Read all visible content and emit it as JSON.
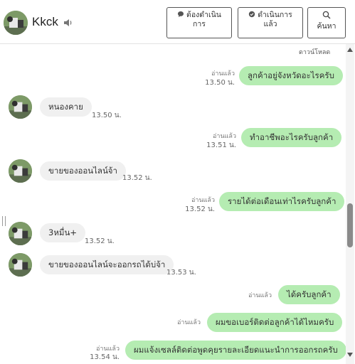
{
  "header": {
    "contact_name": "Kkck",
    "btn_todo_line1": "ต้องดำเนิน",
    "btn_todo_line2": "การ",
    "btn_done_line1": "ดำเนินการ",
    "btn_done_line2": "แล้ว",
    "btn_search_label": "ค้นหา"
  },
  "chat": {
    "download_label": "ดาวน์โหลด",
    "messages": [
      {
        "dir": "out",
        "text": "ลูกค้าอยู่จังหวัดอะไรครับ",
        "read": "อ่านแล้ว",
        "time": "13.50 น."
      },
      {
        "dir": "in",
        "text": "หนองคาย",
        "time": "13.50 น."
      },
      {
        "dir": "out",
        "text": "ทำอาชีพอะไรครับลูกค้า",
        "read": "อ่านแล้ว",
        "time": "13.51 น."
      },
      {
        "dir": "in",
        "text": "ขายของออนไลน์จ้า",
        "time": "13.52 น."
      },
      {
        "dir": "out",
        "text": "รายได้ต่อเดือนเท่าไรครับลูกค้า",
        "read": "อ่านแล้ว",
        "time": "13.52 น."
      },
      {
        "dir": "in",
        "text": "3หมื่น+",
        "time": "13.52 น."
      },
      {
        "dir": "in",
        "text": "ขายของออนไลน์จะออกรถได้บ่จ้า",
        "time": "13.53 น."
      },
      {
        "dir": "out",
        "text": "ได้ครับลูกค้า",
        "read": "อ่านแล้ว",
        "time": ""
      },
      {
        "dir": "out",
        "text": "ผมขอเบอร์ติดต่อลูกค้าได้ไหมครับ",
        "read": "อ่านแล้ว",
        "time": ""
      },
      {
        "dir": "out",
        "text": "ผมแจ้งเซลล์ติดต่อพูดคุยรายละเอียดแนะนำการออกรถครับ",
        "read": "อ่านแล้ว",
        "time": "13.54 น."
      }
    ]
  },
  "colors": {
    "outgoing_bubble": "#b5ecb2",
    "incoming_bubble": "#f0f0f0"
  },
  "icons": {
    "sound": "speaker-icon",
    "todo": "chat-bubble-icon",
    "done": "check-bubble-icon",
    "search": "search-icon"
  }
}
